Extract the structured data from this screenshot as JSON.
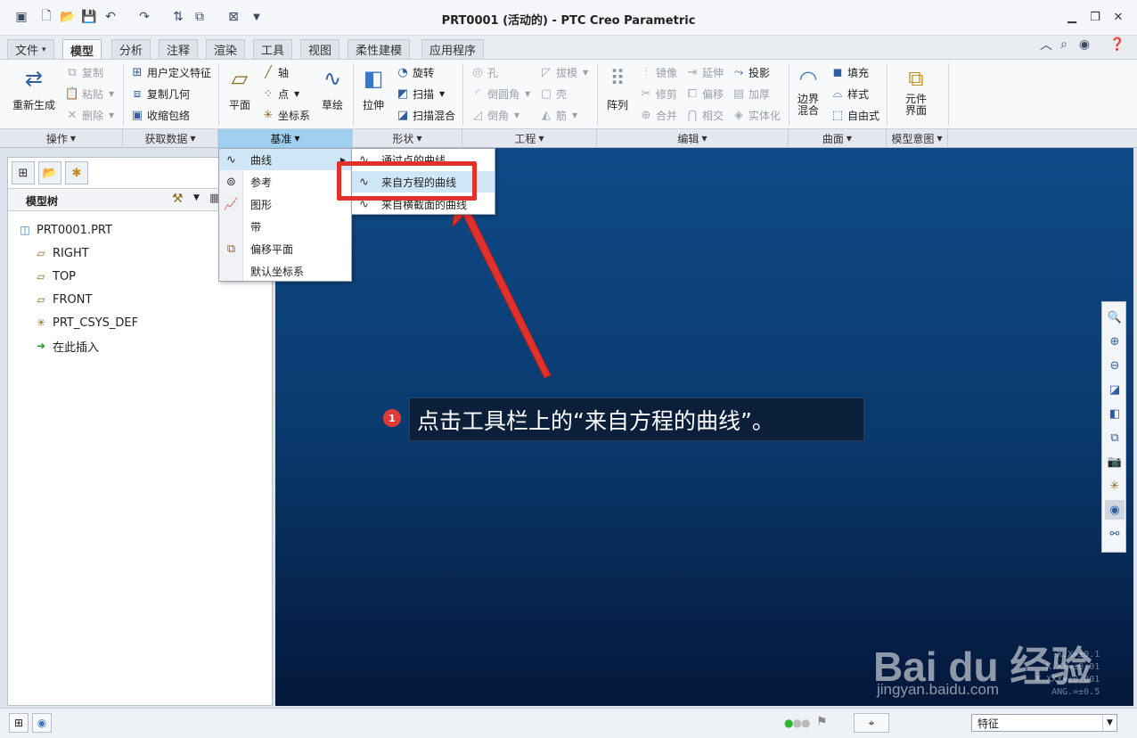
{
  "window": {
    "title": "PRT0001 (活动的) - PTC Creo Parametric"
  },
  "tabs": [
    "文件",
    "模型",
    "分析",
    "注释",
    "渲染",
    "工具",
    "视图",
    "柔性建模",
    "应用程序"
  ],
  "ribbon": {
    "operations": {
      "regenerate": "重新生成",
      "copy": "复制",
      "paste": "粘贴",
      "delete": "删除"
    },
    "get_data": {
      "udf": "用户定义特征",
      "copy_geom": "复制几何",
      "shrinkwrap": "收缩包络"
    },
    "datum": {
      "plane": "平面",
      "axis": "轴",
      "point": "点",
      "csys": "坐标系",
      "sketch": "草绘"
    },
    "shapes": {
      "extrude": "拉伸",
      "revolve": "旋转",
      "sweep": "扫描",
      "swept_blend": "扫描混合"
    },
    "engineering": {
      "hole": "孔",
      "round": "倒圆角",
      "chamfer": "倒角",
      "draft": "拔模",
      "shell": "壳",
      "rib": "筋"
    },
    "editing": {
      "pattern": "阵列",
      "mirror": "镜像",
      "trim": "修剪",
      "merge": "合并",
      "extend": "延伸",
      "offset": "偏移",
      "intersect": "相交",
      "project": "投影",
      "thicken": "加厚",
      "solidify": "实体化"
    },
    "surfaces": {
      "boundary_blend_1": "边界",
      "boundary_blend_2": "混合",
      "fill": "填充",
      "style": "样式",
      "freestyle": "自由式"
    },
    "model_intent": {
      "component_interface_1": "元件",
      "component_interface_2": "界面"
    }
  },
  "groups": {
    "operations": "操作",
    "get_data": "获取数据",
    "datum": "基准",
    "shapes": "形状",
    "engineering": "工程",
    "editing": "编辑",
    "surfaces": "曲面",
    "model_intent": "模型意图"
  },
  "datum_menu": [
    "曲线",
    "参考",
    "图形",
    "带",
    "偏移平面",
    "默认坐标系"
  ],
  "curve_submenu": [
    "通过点的曲线",
    "来自方程的曲线",
    "来自横截面的曲线"
  ],
  "model_tree": {
    "header": "模型树",
    "items": [
      "PRT0001.PRT",
      "RIGHT",
      "TOP",
      "FRONT",
      "PRT_CSYS_DEF",
      "在此插入"
    ]
  },
  "annotation": {
    "number": "1",
    "text": "点击工具栏上的“来自方程的曲线”。"
  },
  "coords": [
    "X.X=±0.1",
    "X.XX=±0.01",
    "X.XXX=±0.001",
    "ANG.=±0.5"
  ],
  "watermark": {
    "brand": "Bai du 经验",
    "url": "jingyan.baidu.com"
  },
  "status": {
    "filter": "特征"
  },
  "colors": {
    "highlight": "#e0312c",
    "viewport_top": "#0f4a88",
    "viewport_bottom": "#04173a",
    "active_group": "#9fd0ef"
  }
}
